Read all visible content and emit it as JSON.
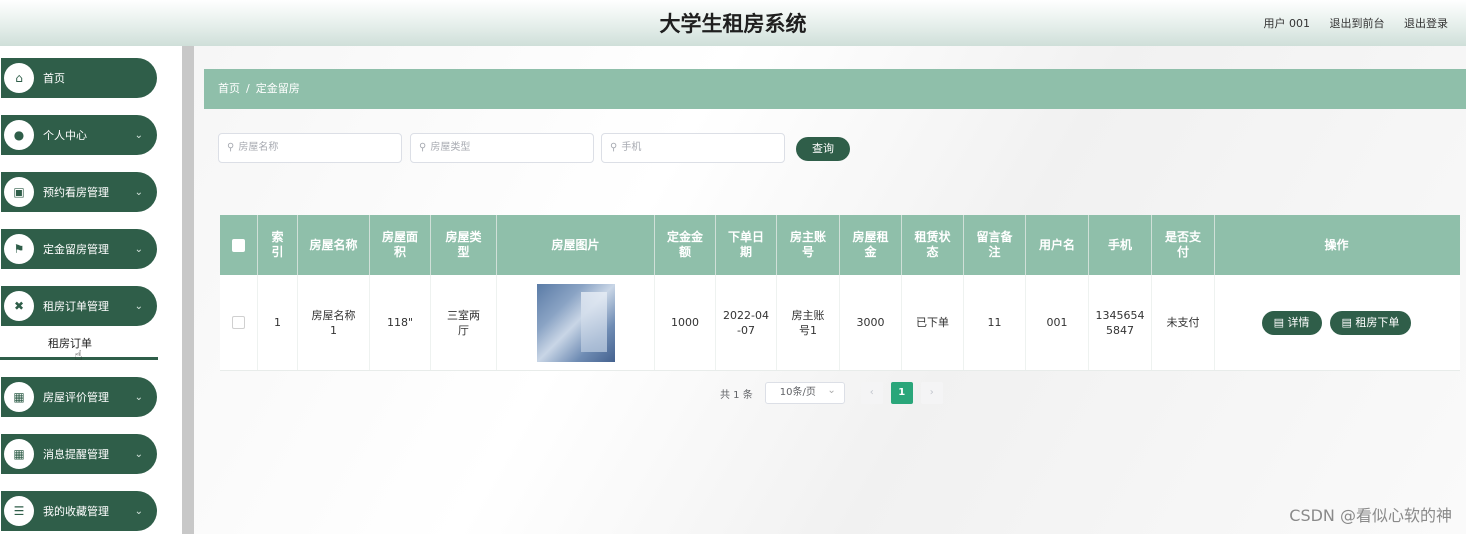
{
  "header": {
    "title": "大学生租房系统",
    "user_text": "用户 001",
    "back_link": "退出到前台",
    "logout_link": "退出登录"
  },
  "sidebar": {
    "items": [
      {
        "label": "首页",
        "icon": "home-icon",
        "glyph": "⌂",
        "chevron": false
      },
      {
        "label": "个人中心",
        "icon": "user-icon",
        "glyph": "●",
        "chevron": true
      },
      {
        "label": "预约看房管理",
        "icon": "clipboard-icon",
        "glyph": "▣",
        "chevron": true
      },
      {
        "label": "定金留房管理",
        "icon": "flag-icon",
        "glyph": "⚑",
        "chevron": true
      },
      {
        "label": "租房订单管理",
        "icon": "ticket-icon",
        "glyph": "✖",
        "chevron": true
      },
      {
        "label": "房屋评价管理",
        "icon": "grid-icon",
        "glyph": "▦",
        "chevron": true
      },
      {
        "label": "消息提醒管理",
        "icon": "grid-icon",
        "glyph": "▦",
        "chevron": true
      },
      {
        "label": "我的收藏管理",
        "icon": "list-icon",
        "glyph": "☰",
        "chevron": true
      }
    ],
    "submenu_label": "租房订单",
    "chevron": "⌄"
  },
  "breadcrumb": {
    "home": "首页",
    "separator": "/",
    "current": "定金留房"
  },
  "search": {
    "name_placeholder": "房屋名称",
    "type_placeholder": "房屋类型",
    "phone_placeholder": "手机",
    "search_icon": "search-icon",
    "query_label": "查询"
  },
  "table": {
    "headers": [
      "索\n引",
      "房屋名称",
      "房屋面\n积",
      "房屋类\n型",
      "房屋图片",
      "定金金\n额",
      "下单日\n期",
      "房主账\n号",
      "房屋租\n金",
      "租赁状\n态",
      "留言备\n注",
      "用户名",
      "手机",
      "是否支\n付",
      "操作"
    ],
    "rows": [
      {
        "index": "1",
        "name": "房屋名称\n1",
        "area": "118\"",
        "type": "三室两\n厅",
        "deposit": "1000",
        "date": "2022-04\n-07",
        "owner": "房主账\n号1",
        "rent": "3000",
        "status": "已下单",
        "remark": "11",
        "username": "001",
        "phone": "1345654\n5847",
        "paid": "未支付",
        "detail_label": "详情",
        "order_label": "租房下单"
      }
    ]
  },
  "pagination": {
    "total": "共 1 条",
    "page_size": "10条/页",
    "prev": "‹",
    "current": "1",
    "next": "›"
  },
  "watermark": "CSDN @看似心软的神",
  "colors": {
    "primary": "#2f5e49",
    "header_row": "#8fbfaa",
    "active_page": "#2aa67a"
  }
}
